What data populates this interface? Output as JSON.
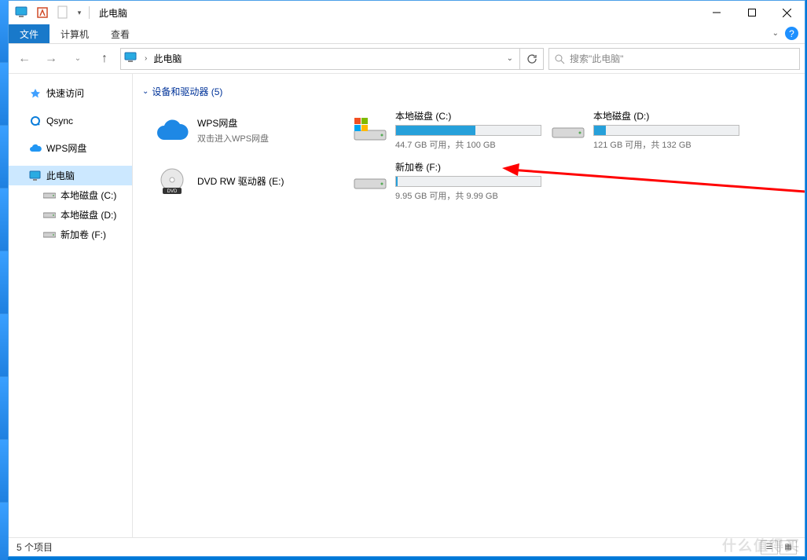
{
  "title": "此电脑",
  "ribbon": {
    "file": "文件",
    "computer": "计算机",
    "view": "查看"
  },
  "address": {
    "location": "此电脑"
  },
  "search": {
    "placeholder": "搜索\"此电脑\""
  },
  "nav": {
    "quick_access": "快速访问",
    "qsync": "Qsync",
    "wps": "WPS网盘",
    "this_pc": "此电脑",
    "drive_c": "本地磁盘 (C:)",
    "drive_d": "本地磁盘 (D:)",
    "drive_f": "新加卷 (F:)"
  },
  "section": {
    "header": "设备和驱动器 (5)"
  },
  "tiles": {
    "wps": {
      "title": "WPS网盘",
      "sub": "双击进入WPS网盘"
    },
    "c": {
      "title": "本地磁盘 (C:)",
      "sub": "44.7 GB 可用，共 100 GB",
      "fill": 55
    },
    "d": {
      "title": "本地磁盘 (D:)",
      "sub": "121 GB 可用，共 132 GB",
      "fill": 8
    },
    "dvd": {
      "title": "DVD RW 驱动器 (E:)"
    },
    "f": {
      "title": "新加卷 (F:)",
      "sub": "9.95 GB 可用，共 9.99 GB",
      "fill": 1
    }
  },
  "status": {
    "count": "5 个项目"
  },
  "watermark": "什么值得买"
}
